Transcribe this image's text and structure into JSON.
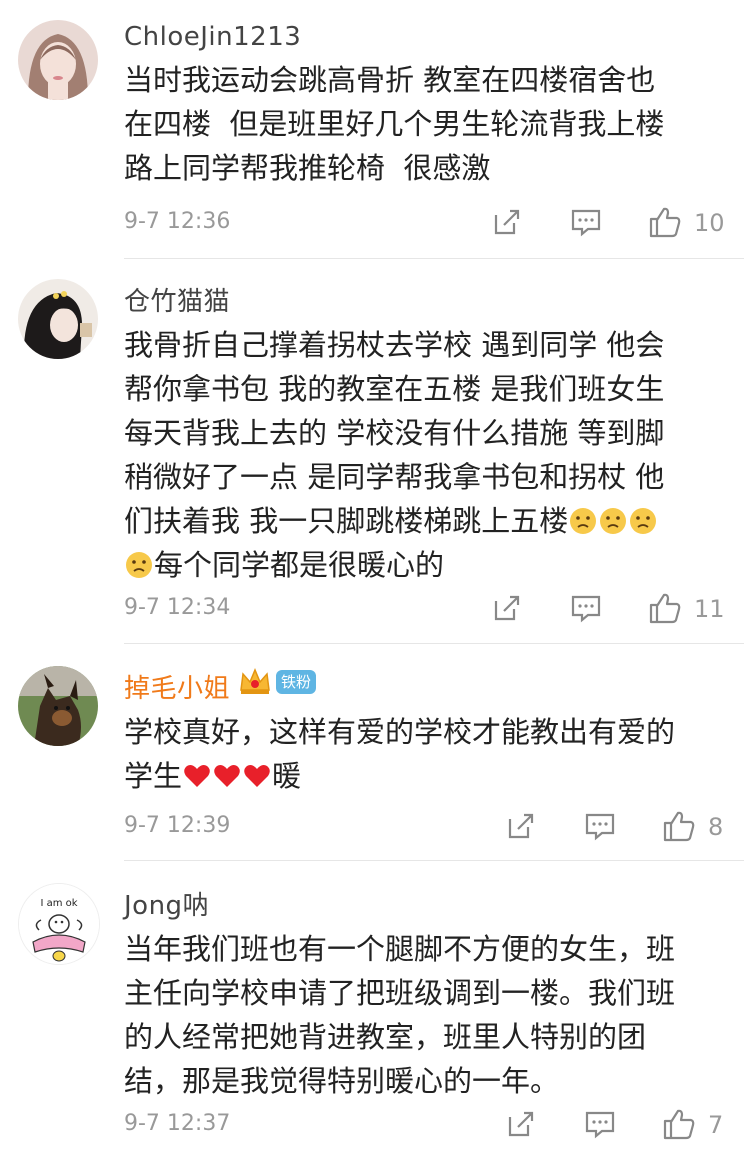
{
  "comments": [
    {
      "username": "ChloeJin1213",
      "text_lines": [
        "当时我运动会跳高骨折 教室在四楼宿舍也",
        "在四楼  但是班里好几个男生轮流背我上楼",
        "路上同学帮我推轮椅  很感激"
      ],
      "time": "9-7 12:36",
      "likes": "10",
      "avatar_icon": "user-avatar"
    },
    {
      "username": "仓竹猫猫",
      "text_lines": [
        "我骨折自己撑着拐杖去学校 遇到同学 他会",
        "帮你拿书包 我的教室在五楼 是我们班女生",
        "每天背我上去的 学校没有什么措施 等到脚",
        "稍微好了一点 是同学帮我拿书包和拐杖 他",
        "们扶着我 我一只脚跳楼梯跳上五楼",
        "每个同学都是很暖心的"
      ],
      "time": "9-7 12:34",
      "likes": "11",
      "avatar_icon": "user-avatar",
      "emoji_icon": "sad-emoji"
    },
    {
      "username": "掉毛小姐",
      "badge": "铁粉",
      "text_lines": [
        "学校真好，这样有爱的学校才能教出有爱的",
        "学生",
        "暖"
      ],
      "time": "9-7 12:39",
      "likes": "8",
      "avatar_icon": "dog-avatar",
      "emoji_icon": "red-heart-emoji"
    },
    {
      "username": "Jong呐",
      "text_lines": [
        "当年我们班也有一个腿脚不方便的女生，班",
        "主任向学校申请了把班级调到一楼。我们班",
        "的人经常把她背进教室，班里人特别的团",
        "结，那是我觉得特别暖心的一年。"
      ],
      "time": "9-7 12:37",
      "likes": "7",
      "avatar_icon": "cartoon-avatar",
      "avatar_text": "I am ok"
    }
  ],
  "colors": {
    "username": "#444444",
    "vip_username": "#f07a1a",
    "meta": "#999999",
    "badge": "#5fb5e3",
    "heart": "#e8202a"
  }
}
